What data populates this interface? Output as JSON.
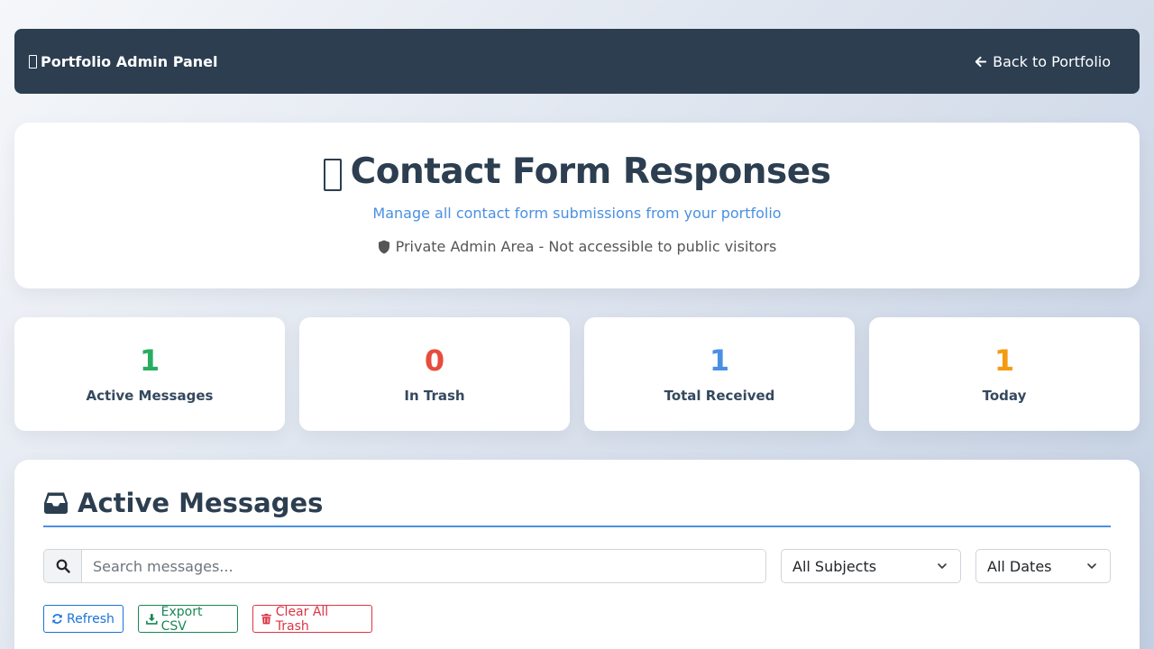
{
  "navbar": {
    "brand": "Portfolio Admin Panel",
    "brand_icon": "clipboard-icon",
    "back_label": "Back to Portfolio",
    "back_icon": "arrow-left-icon"
  },
  "hero": {
    "title": "Contact Form Responses",
    "title_icon": "clipboard-icon",
    "subtitle": "Manage all contact form submissions from your portfolio",
    "note": "Private Admin Area - Not accessible to public visitors",
    "note_icon": "shield-icon"
  },
  "stats": [
    {
      "value": "1",
      "label": "Active Messages",
      "color": "#27ae60"
    },
    {
      "value": "0",
      "label": "In Trash",
      "color": "#e74c3c"
    },
    {
      "value": "1",
      "label": "Total Received",
      "color": "#4a90e2"
    },
    {
      "value": "1",
      "label": "Today",
      "color": "#f39c12"
    }
  ],
  "messages": {
    "title": "Active Messages",
    "title_icon": "inbox-icon",
    "search": {
      "placeholder": "Search messages...",
      "value": "",
      "icon": "search-icon"
    },
    "subject_filter": {
      "selected": "All Subjects"
    },
    "date_filter": {
      "selected": "All Dates"
    },
    "buttons": {
      "refresh": "Refresh",
      "export": "Export CSV",
      "clear_trash": "Clear All Trash"
    }
  },
  "colors": {
    "navbar_bg": "#2c3e50",
    "accent": "#4a90e2",
    "refresh": "#1a73d9",
    "export": "#198754",
    "clear_trash": "#dc3545"
  }
}
